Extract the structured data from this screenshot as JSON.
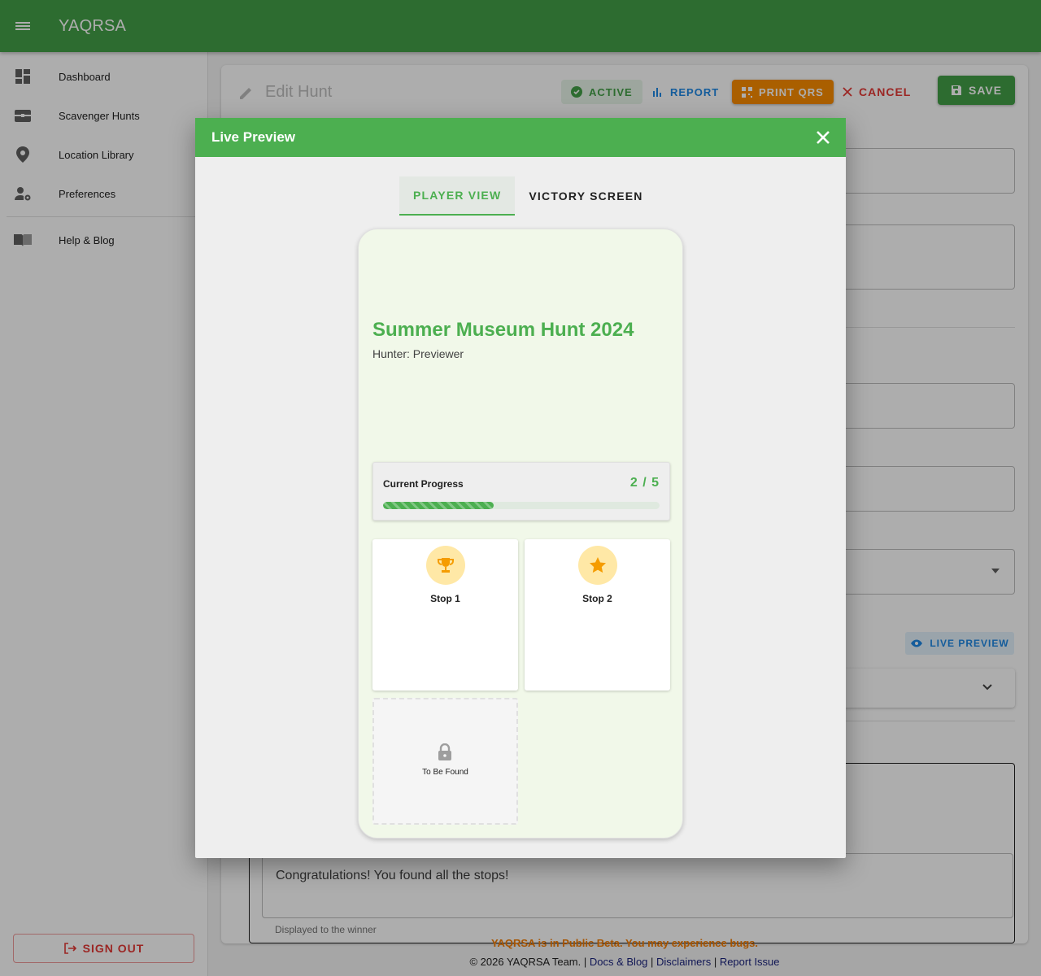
{
  "app": {
    "title": "YAQRSA"
  },
  "sidebar": {
    "items": [
      {
        "label": "Dashboard",
        "icon": "dashboard-icon"
      },
      {
        "label": "Scavenger Hunts",
        "icon": "treasure-chest-icon"
      },
      {
        "label": "Location Library",
        "icon": "location-pin-icon"
      },
      {
        "label": "Preferences",
        "icon": "user-settings-icon"
      },
      {
        "label": "Help & Blog",
        "icon": "book-icon"
      }
    ],
    "signout_label": "SIGN OUT"
  },
  "editor": {
    "title": "Edit Hunt",
    "active_label": "ACTIVE",
    "report_label": "REPORT",
    "print_label": "PRINT QRS",
    "cancel_label": "CANCEL",
    "save_label": "SAVE",
    "live_preview_label": "LIVE PREVIEW",
    "victory_message": "Congratulations! You found all the stops!",
    "victory_helper": "Displayed to the winner"
  },
  "footer": {
    "beta": "YAQRSA is in Public Beta. You may experience bugs.",
    "copyright": "© 2026 YAQRSA Team.",
    "links": [
      "Docs & Blog",
      "Disclaimers",
      "Report Issue"
    ]
  },
  "dialog": {
    "title": "Live Preview",
    "tabs": [
      {
        "label": "PLAYER VIEW",
        "active": true
      },
      {
        "label": "VICTORY SCREEN",
        "active": false
      }
    ],
    "preview": {
      "hunt_title": "Summer Museum Hunt 2024",
      "hunter": "Hunter: Previewer",
      "progress_label": "Current Progress",
      "progress_text": "2 / 5",
      "progress_found": 2,
      "progress_total": 5,
      "stops": [
        {
          "name": "Stop 1",
          "icon": "trophy-icon"
        },
        {
          "name": "Stop 2",
          "icon": "star-icon"
        }
      ],
      "locked_label": "To Be Found"
    }
  },
  "colors": {
    "primary": "#43a047",
    "accent_orange": "#fb8c00",
    "danger": "#e53935",
    "link_blue": "#1e88e5"
  }
}
